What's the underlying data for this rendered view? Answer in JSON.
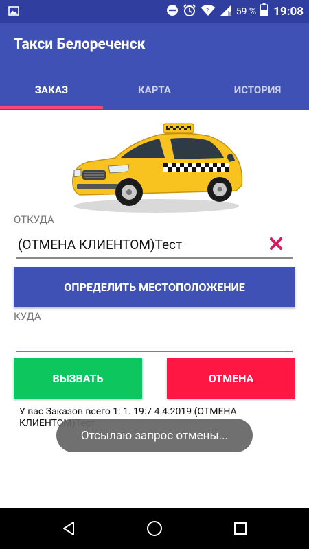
{
  "status_bar": {
    "battery_percent": "59 %",
    "time": "19:08",
    "icons": [
      "image-icon",
      "do-not-disturb-icon",
      "alarm-icon",
      "wifi-icon",
      "signal-icon",
      "battery-icon"
    ]
  },
  "app": {
    "title": "Такси Белореченск"
  },
  "tabs": [
    {
      "label": "ЗАКАЗ",
      "active": true
    },
    {
      "label": "КАРТА",
      "active": false
    },
    {
      "label": "ИСТОРИЯ",
      "active": false
    }
  ],
  "form": {
    "from_label": "ОТКУДА",
    "from_value": "(ОТМЕНА КЛИЕНТОМ)Тест",
    "locate_button": "ОПРЕДЕЛИТЬ МЕСТОПОЛОЖЕНИЕ",
    "to_label": "КУДА",
    "to_value": ""
  },
  "actions": {
    "call_button": "ВЫЗВАТЬ",
    "cancel_button": "ОТМЕНА"
  },
  "orders_info": "У вас Заказов всего 1:  1. 19:7 4.4.2019 (ОТМЕНА КЛИЕНТОМ)Тест",
  "toast": "Отсылаю запрос отмены...",
  "colors": {
    "primary": "#3F51B5",
    "primary_dark": "#303F9F",
    "accent": "#FF4081",
    "call": "#0DC65D",
    "cancel": "#FF1744",
    "clear_icon": "#D81B60"
  }
}
